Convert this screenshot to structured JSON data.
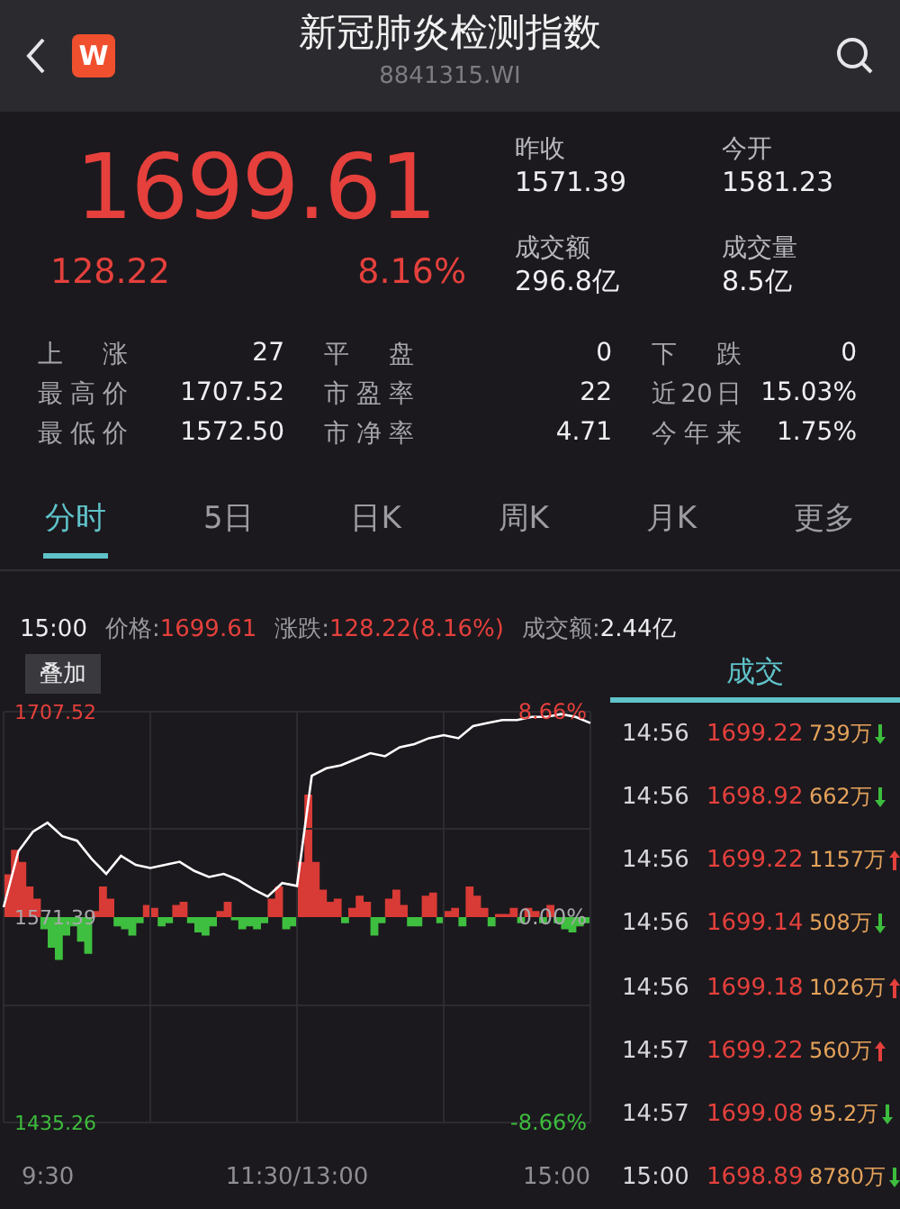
{
  "header": {
    "logo": "W",
    "title": "新冠肺炎检测指数",
    "code": "8841315.WI"
  },
  "quote": {
    "price": "1699.61",
    "change": "128.22",
    "percent": "8.16%",
    "summary": [
      {
        "label": "昨收",
        "value": "1571.39"
      },
      {
        "label": "今开",
        "value": "1581.23"
      },
      {
        "label": "成交额",
        "value": "296.8亿"
      },
      {
        "label": "成交量",
        "value": "8.5亿"
      }
    ]
  },
  "stats": [
    {
      "label": "上 涨",
      "value": "27"
    },
    {
      "label": "平 盘",
      "value": "0"
    },
    {
      "label": "下 跌",
      "value": "0"
    },
    {
      "label": "最高价",
      "value": "1707.52"
    },
    {
      "label": "市盈率",
      "value": "22"
    },
    {
      "label": "近20日",
      "value": "15.03%"
    },
    {
      "label": "最低价",
      "value": "1572.50"
    },
    {
      "label": "市净率",
      "value": "4.71"
    },
    {
      "label": "今年来",
      "value": "1.75%"
    }
  ],
  "tabs": [
    {
      "label": "分时",
      "selected": true
    },
    {
      "label": "5日",
      "selected": false
    },
    {
      "label": "日K",
      "selected": false
    },
    {
      "label": "周K",
      "selected": false
    },
    {
      "label": "月K",
      "selected": false
    },
    {
      "label": "更多",
      "selected": false
    }
  ],
  "info": {
    "time": "15:00",
    "items": [
      {
        "label": "价格:",
        "value": "1699.61",
        "kind": "up"
      },
      {
        "label": "涨跌:",
        "value": "128.22(8.16%)",
        "kind": "up"
      },
      {
        "label": "成交额:",
        "value": "2.44亿",
        "kind": "plain"
      }
    ]
  },
  "chart": {
    "overlay_button": "叠加",
    "time_labels": [
      "9:30",
      "11:30/13:00",
      "15:00"
    ],
    "percent_labels": [
      "8.66%",
      "0.00%",
      "-8.66%"
    ],
    "chart_data": {
      "type": "line",
      "grid": true,
      "ylim": [
        1435.26,
        1707.52
      ],
      "yticks": [
        {
          "value": 1707.52,
          "label": "1707.52"
        },
        {
          "value": 1571.39,
          "label": "1571.39"
        },
        {
          "value": 1435.26,
          "label": "1435.26"
        }
      ],
      "series": [
        {
          "color": "#ffffff",
          "values": [
            1578,
            1615,
            1628,
            1634,
            1625,
            1622,
            1610,
            1600,
            1612,
            1606,
            1604,
            1606,
            1608,
            1602,
            1598,
            1600,
            1596,
            1590,
            1585,
            1594,
            1592,
            1665,
            1670,
            1672,
            1676,
            1680,
            1678,
            1684,
            1686,
            1690,
            1692,
            1690,
            1698,
            1700,
            1702,
            1702,
            1704,
            1704,
            1706,
            1704,
            1700
          ]
        }
      ]
    }
  },
  "trades": {
    "title": "成交",
    "rows": [
      {
        "time": "14:56",
        "price": "1699.22",
        "volume": "739万",
        "up": false
      },
      {
        "time": "14:56",
        "price": "1698.92",
        "volume": "662万",
        "up": false
      },
      {
        "time": "14:56",
        "price": "1699.22",
        "volume": "1157万",
        "up": true
      },
      {
        "time": "14:56",
        "price": "1699.14",
        "volume": "508万",
        "up": false
      },
      {
        "time": "14:56",
        "price": "1699.18",
        "volume": "1026万",
        "up": true
      },
      {
        "time": "14:57",
        "price": "1699.22",
        "volume": "560万",
        "up": true
      },
      {
        "time": "14:57",
        "price": "1699.08",
        "volume": "95.2万",
        "up": false
      },
      {
        "time": "15:00",
        "price": "1698.89",
        "volume": "8780万",
        "up": false
      }
    ]
  }
}
